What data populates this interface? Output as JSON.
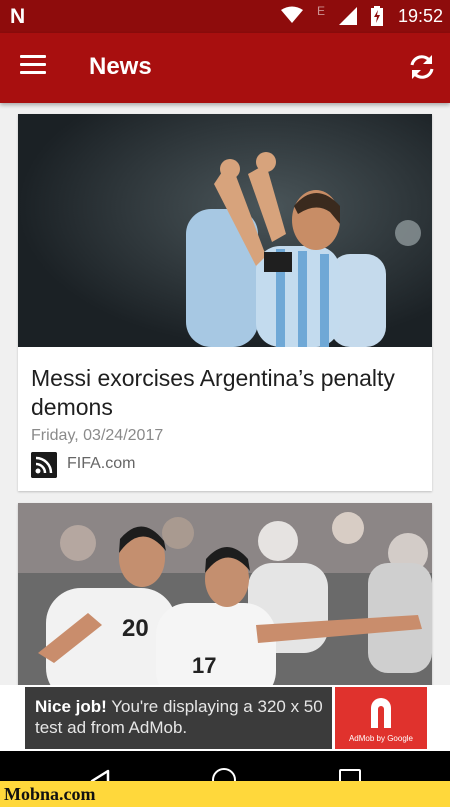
{
  "status_bar": {
    "time": "19:52",
    "network_label": "E",
    "app_icon": "n-logo-icon"
  },
  "app_bar": {
    "title": "News",
    "menu_icon": "menu-icon",
    "refresh_icon": "refresh-icon"
  },
  "articles": [
    {
      "headline": "Messi exorcises Argentina’s penalty demons",
      "date": "Friday, 03/24/2017",
      "source": "FIFA.com",
      "source_icon": "rss-feed-icon"
    },
    {
      "headline": "",
      "date": "",
      "source": ""
    }
  ],
  "ad": {
    "bold": "Nice job!",
    "text": " You're displaying a 320 x 50 test ad from AdMob.",
    "byline": "AdMob by Google",
    "accent": "#e0322d"
  },
  "nav": {
    "back_icon": "back-icon",
    "home_icon": "home-icon",
    "recents_icon": "recents-icon"
  },
  "watermark": "Mobna.com"
}
